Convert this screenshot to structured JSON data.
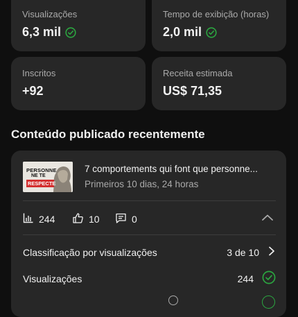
{
  "stats": {
    "views": {
      "label": "Visualizações",
      "value": "6,3 mil"
    },
    "watch_time": {
      "label": "Tempo de exibição (horas)",
      "value": "2,0 mil"
    },
    "subscribers": {
      "label": "Inscritos",
      "value": "+92"
    },
    "revenue": {
      "label": "Receita estimada",
      "value": "US$ 71,35"
    }
  },
  "recent_content": {
    "title": "Conteúdo publicado recentemente",
    "video": {
      "thumbnail_text_line1": "PERSONNE",
      "thumbnail_text_line2": "NE TE",
      "thumbnail_text_line3": "RESPECTE",
      "title": "7 comportements qui font que personne...",
      "subtitle": "Primeiros 10 dias, 24 horas",
      "views_count": "244",
      "likes_count": "10",
      "comments_count": "0"
    },
    "rows": [
      {
        "label": "Classificação por visualizações",
        "value": "3 de 10"
      },
      {
        "label": "Visualizações",
        "value": "244"
      }
    ]
  },
  "colors": {
    "background": "#0f0f0f",
    "card": "#272727",
    "success": "#2ba640",
    "muted": "#aaaaaa"
  }
}
